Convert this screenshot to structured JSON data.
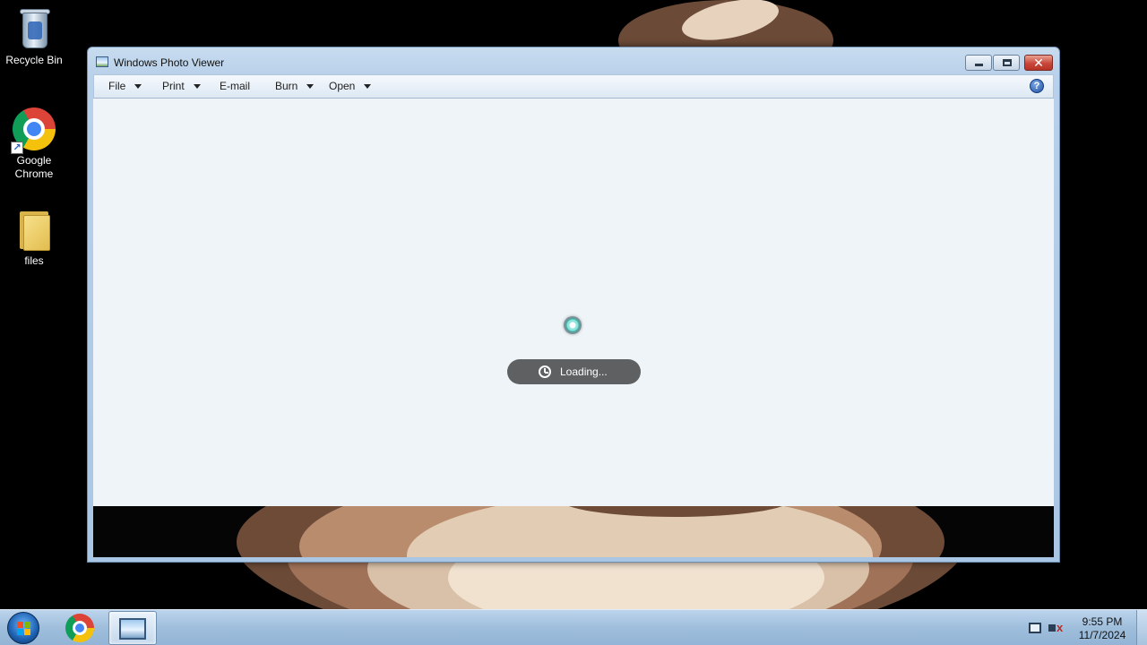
{
  "desktop": {
    "icons": [
      {
        "label": "Recycle Bin",
        "icon": "recycle-bin-icon"
      },
      {
        "label": "Google Chrome",
        "icon": "chrome-icon"
      },
      {
        "label": "files",
        "icon": "folder-icon"
      }
    ]
  },
  "window": {
    "title": "Windows Photo Viewer",
    "menu": [
      {
        "label": "File",
        "has_dropdown": true
      },
      {
        "label": "Print",
        "has_dropdown": true
      },
      {
        "label": "E-mail",
        "has_dropdown": false
      },
      {
        "label": "Burn",
        "has_dropdown": true
      },
      {
        "label": "Open",
        "has_dropdown": true
      }
    ],
    "help_symbol": "?",
    "close_symbol": "✕",
    "status": {
      "loading_text": "Loading..."
    }
  },
  "taskbar": {
    "pinned": [
      "chrome-icon",
      "photo-viewer-icon"
    ],
    "clock": {
      "time": "9:55 PM",
      "date": "11/7/2024"
    },
    "volume_muted_symbol": "x"
  },
  "colors": {
    "viewer_bg": "#eef4f8",
    "loading_pill": "#5e6062",
    "close_button": "#c9473a",
    "taskbar": "#9fbedc"
  }
}
